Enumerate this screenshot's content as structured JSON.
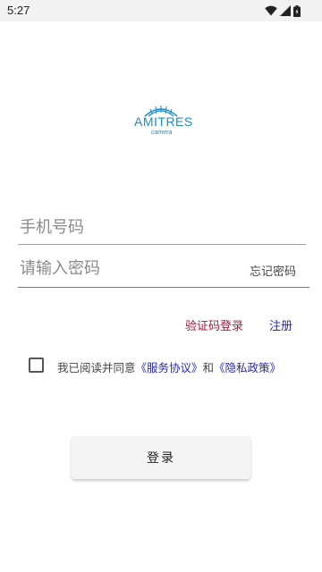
{
  "status_bar": {
    "time": "5:27"
  },
  "logo": {
    "brand": "AMITRES",
    "sub": "camera"
  },
  "form": {
    "phone_placeholder": "手机号码",
    "password_placeholder": "请输入密码",
    "forgot_password": "忘记密码"
  },
  "links": {
    "sms_login": "验证码登录",
    "register": "注册"
  },
  "agreement": {
    "prefix": "我已阅读并同意",
    "service_link": "《服务协议》",
    "conjunction": "和",
    "privacy_link": "《隐私政策》"
  },
  "login_button": {
    "label": "登录"
  },
  "colors": {
    "accent_red": "#a01a3c",
    "link_blue": "#2a2aaa",
    "logo_blue": "#1a8ccf"
  }
}
